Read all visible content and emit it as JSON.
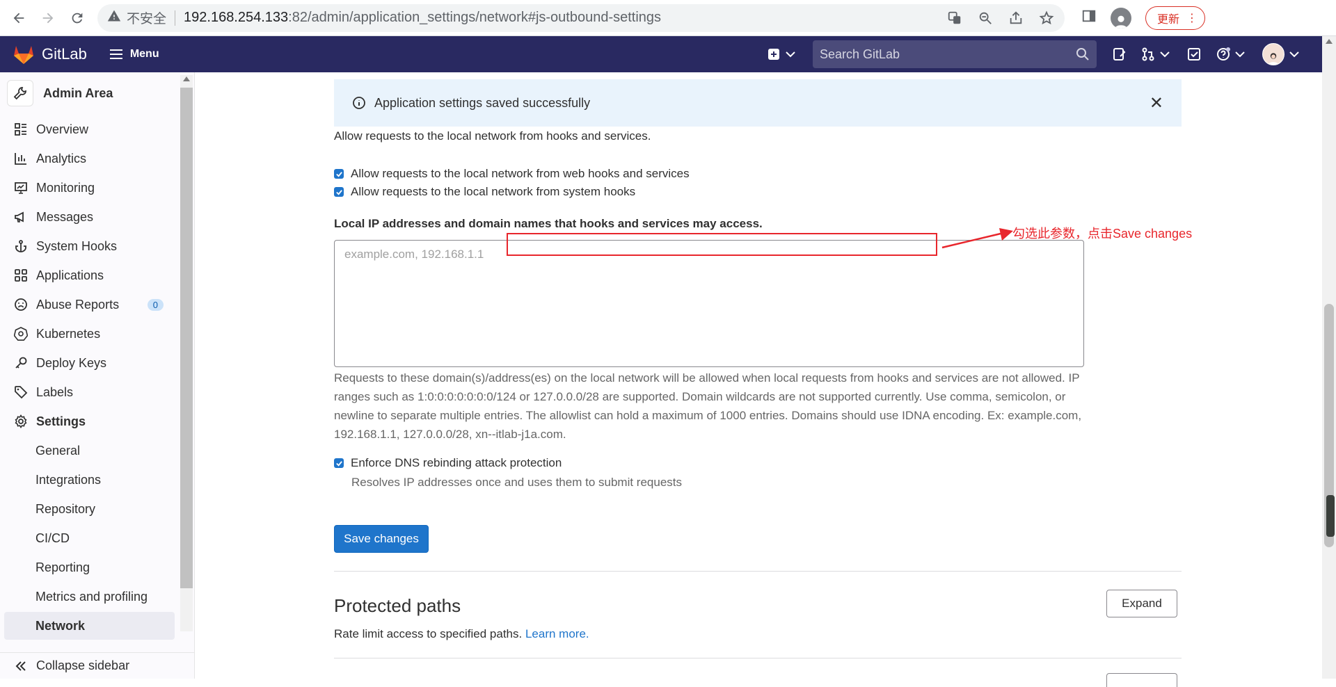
{
  "browser": {
    "insecure_label": "不安全",
    "url_host": "192.168.254.133",
    "url_path": ":82/admin/application_settings/network#js-outbound-settings",
    "update_label": "更新"
  },
  "header": {
    "brand": "GitLab",
    "menu_label": "Menu",
    "search_placeholder": "Search GitLab"
  },
  "sidebar": {
    "context_title": "Admin Area",
    "items": [
      {
        "label": "Overview",
        "icon": "overview-icon"
      },
      {
        "label": "Analytics",
        "icon": "analytics-icon"
      },
      {
        "label": "Monitoring",
        "icon": "monitoring-icon"
      },
      {
        "label": "Messages",
        "icon": "messages-icon"
      },
      {
        "label": "System Hooks",
        "icon": "hook-icon"
      },
      {
        "label": "Applications",
        "icon": "applications-icon"
      },
      {
        "label": "Abuse Reports",
        "icon": "abuse-icon",
        "badge": "0"
      },
      {
        "label": "Kubernetes",
        "icon": "kubernetes-icon"
      },
      {
        "label": "Deploy Keys",
        "icon": "key-icon"
      },
      {
        "label": "Labels",
        "icon": "label-icon"
      },
      {
        "label": "Settings",
        "icon": "settings-icon"
      }
    ],
    "settings_sub": [
      "General",
      "Integrations",
      "Repository",
      "CI/CD",
      "Reporting",
      "Metrics and profiling",
      "Network"
    ],
    "collapse_label": "Collapse sidebar"
  },
  "alert": {
    "message": "Application settings saved successfully"
  },
  "outbound": {
    "intro": "Allow requests to the local network from hooks and services.",
    "cb_web_hooks": "Allow requests to the local network from web hooks and services",
    "cb_system_hooks": "Allow requests to the local network from system hooks",
    "allowlist_label": "Local IP addresses and domain names that hooks and services may access.",
    "allowlist_placeholder": "example.com, 192.168.1.1",
    "help_text": "Requests to these domain(s)/address(es) on the local network will be allowed when local requests from hooks and services are not allowed. IP ranges such as 1:0:0:0:0:0:0:0/124 or 127.0.0.0/28 are supported. Domain wildcards are not supported currently. Use comma, semicolon, or newline to separate multiple entries. The allowlist can hold a maximum of 1000 entries. Domains should use IDNA encoding. Ex: example.com, 192.168.1.1, 127.0.0.0/28, xn--itlab-j1a.com.",
    "cb_dns": "Enforce DNS rebinding attack protection",
    "cb_dns_help": "Resolves IP addresses once and uses them to submit requests",
    "save_label": "Save changes"
  },
  "protected_paths": {
    "title": "Protected paths",
    "desc": "Rate limit access to specified paths.",
    "learn_more": "Learn more.",
    "expand_label": "Expand"
  },
  "annotation": {
    "note": "勾选此参数，点击Save changes"
  },
  "colors": {
    "header_bg": "#292961",
    "accent": "#1f75cb",
    "annotation": "#e8262c"
  }
}
